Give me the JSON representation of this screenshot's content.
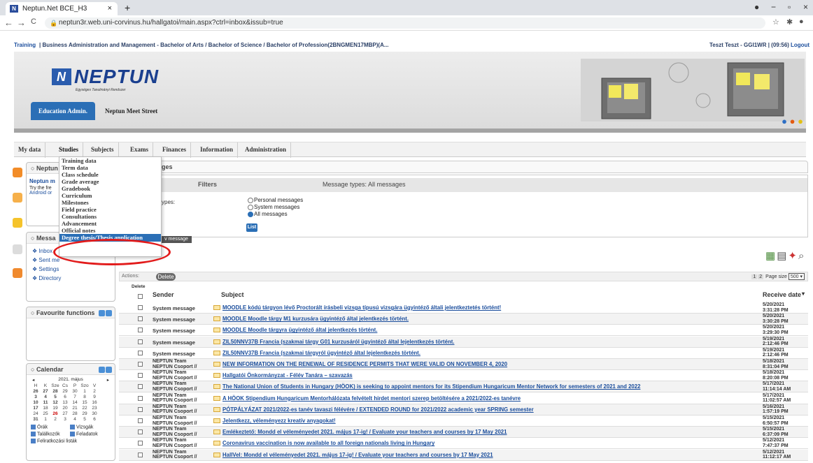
{
  "browser": {
    "tab_title": "Neptun.Net BCE_H3",
    "tab_close": "×",
    "new_tab": "+",
    "url": "neptun3r.web.uni-corvinus.hu/hallgatoi/main.aspx?ctrl=inbox&issub=true",
    "back": "←",
    "forward": "→",
    "reload": "C",
    "lock": "🔒",
    "win_min": "−",
    "win_max": "▫",
    "win_close": "×"
  },
  "topline": {
    "training_link": "Training",
    "program": "| Business Administration and Management - Bachelor of Arts / Bachelor of Science / Bachelor of Profession(2BNGMEN17MBP)(A...",
    "user": "Teszt Teszt - GGI1WR | (09:56)",
    "logout": "Logout"
  },
  "header": {
    "logo": "NEPTUN",
    "logo_box": "N",
    "logo_sub": "Egységes Tanulmányi Rendszer",
    "edu_admin": "Education Admin.",
    "meet_street": "Neptun Meet Street"
  },
  "menu": [
    "My data",
    "Studies",
    "Subjects",
    "Exams",
    "Finances",
    "Information",
    "Administration"
  ],
  "studies_dropdown": [
    "Training data",
    "Term data",
    "Class schedule",
    "Grade average",
    "Gradebook",
    "Curriculum",
    "Milestones",
    "Field practice",
    "Consultations",
    "Advancement",
    "Official notes",
    "Degree thesis/Thesis application"
  ],
  "neptun_box": {
    "title": "Neptun",
    "line1": "Neptun m",
    "line2": "Try the fre",
    "line3": "Android or"
  },
  "messages_box": {
    "title": "Messa",
    "items": [
      "Inbox",
      "Sent me",
      "Settings",
      "Directory"
    ]
  },
  "favourites": {
    "title": "Favourite functions"
  },
  "calendar": {
    "title": "Calendar",
    "month": "2021. május",
    "prev": "◂",
    "next": "▸",
    "weekdays": [
      "H",
      "K",
      "Sze",
      "Cs",
      "P",
      "Szo",
      "V"
    ],
    "weeks": [
      [
        "26",
        "27",
        "28",
        "29",
        "30",
        "1",
        "2"
      ],
      [
        "3",
        "4",
        "5",
        "6",
        "7",
        "8",
        "9"
      ],
      [
        "10",
        "11",
        "12",
        "13",
        "14",
        "15",
        "16"
      ],
      [
        "17",
        "18",
        "19",
        "20",
        "21",
        "22",
        "23"
      ],
      [
        "24",
        "25",
        "26",
        "27",
        "28",
        "29",
        "30"
      ],
      [
        "31",
        "1",
        "2",
        "3",
        "4",
        "5",
        "6"
      ]
    ],
    "checks": [
      "Órák",
      "Vizsgák",
      "Találkozók",
      "Feladatok",
      "Feliratkozási listák"
    ]
  },
  "content": {
    "header": "ges",
    "filters": "Filters",
    "message_types": "Message types: All messages",
    "types_label": "ypes:",
    "radio": [
      "Personal messages",
      "System messages",
      "All messages"
    ],
    "list_btn": "List",
    "new_message": "v message"
  },
  "actions": {
    "label": "Actions:",
    "delete": "Delete",
    "pages": [
      "1",
      "2"
    ],
    "page_size_label": "Page size",
    "page_size": "500 ▾"
  },
  "table": {
    "col_delete": "Delete",
    "col_sender": "Sender",
    "col_subject": "Subject",
    "col_date": "Receive date",
    "rows": [
      {
        "sender": "System message",
        "subject": "MOODLE kódú tárgyon lévő Proctorált írásbeli vizsga típusú vizsgára ügyintéző általi jelentkeztetés történt!",
        "date": "5/20/2021",
        "time": "3:31:28 PM"
      },
      {
        "sender": "System message",
        "subject": "MOODLE Moodle tárgy M1 kurzusára ügyintéző által jelentkezés történt.",
        "date": "5/20/2021",
        "time": "3:30:28 PM"
      },
      {
        "sender": "System message",
        "subject": "MOODLE Moodle tárgyra ügyintéző által jelentkezés történt.",
        "date": "5/20/2021",
        "time": "3:29:30 PM"
      },
      {
        "sender": "System message",
        "subject": "ZIL50NNV37B Francia (szakmai tárgy G01 kurzusáról ügyintéző által lejelentkezés történt.",
        "date": "5/19/2021",
        "time": "2:12:46 PM"
      },
      {
        "sender": "System message",
        "subject": "ZIL50NNV37B Francia (szakmai tárgyról ügyintéző által lejelentkezés történt.",
        "date": "5/19/2021",
        "time": "2:12:46 PM"
      },
      {
        "sender": "NEPTUN Team",
        "sender2": "NEPTUN Csoport //",
        "subject": "NEW INFORMATION ON THE RENEWAL OF RESIDENCE PERMITS THAT WERE VALID ON NOVEMBER 4, 2020",
        "date": "5/18/2021",
        "time": "8:31:04 PM"
      },
      {
        "sender": "NEPTUN Team",
        "sender2": "NEPTUN Csoport //",
        "subject": "Hallgatói Önkormányzat - Félév Tanára – szavazás",
        "date": "5/18/2021",
        "time": "8:20:08 PM"
      },
      {
        "sender": "NEPTUN Team",
        "sender2": "NEPTUN Csoport //",
        "subject": "The National Union of Students in Hungary (HÖOK) is seeking to appoint mentors for its Stipendium Hungaricum Mentor Network for semesters of 2021 and 2022",
        "date": "5/17/2021",
        "time": "11:14:14 AM"
      },
      {
        "sender": "NEPTUN Team",
        "sender2": "NEPTUN Csoport //",
        "subject": "A HÖOK Stipendium Hungaricum Mentorhálózata felvételt hirdet mentori szerep betöltésére a 2021/2022-es tanévre",
        "date": "5/17/2021",
        "time": "11:02:57 AM"
      },
      {
        "sender": "NEPTUN Team",
        "sender2": "NEPTUN Csoport //",
        "subject": "PÓTPÁLYÁZAT 2021/2022-es tanév tavaszi félévére / EXTENDED ROUND for 2021/2022 academic year SPRING semester",
        "date": "5/16/2021",
        "time": "1:57:19 PM"
      },
      {
        "sender": "NEPTUN Team",
        "sender2": "NEPTUN Csoport //",
        "subject": "Jelentkezz, véleményezz kreatív anyagokat!",
        "date": "5/15/2021",
        "time": "6:50:57 PM"
      },
      {
        "sender": "NEPTUN Team",
        "sender2": "NEPTUN Csoport //",
        "subject": "Emlékeztető: Mondd el véleményedet 2021. május 17-ig! / Evaluate your teachers and courses by 17 May 2021",
        "date": "5/15/2021",
        "time": "6:37:09 PM"
      },
      {
        "sender": "NEPTUN Team",
        "sender2": "NEPTUN Csoport //",
        "subject": "Coronavirus vaccination is now available to all foreign nationals living in Hungary",
        "date": "5/12/2021",
        "time": "7:47:37 PM"
      },
      {
        "sender": "NEPTUN Team",
        "sender2": "NEPTUN Csoport //",
        "subject": "HallVel: Mondd el véleményedet 2021. május 17-ig! / Evaluate your teachers and courses by 17 May 2021",
        "date": "5/12/2021",
        "time": "11:12:17 AM"
      }
    ]
  },
  "colors": {
    "accent": "#2b6fb6",
    "link": "#1a4d9c",
    "highlight_circle": "#e21b1b"
  }
}
